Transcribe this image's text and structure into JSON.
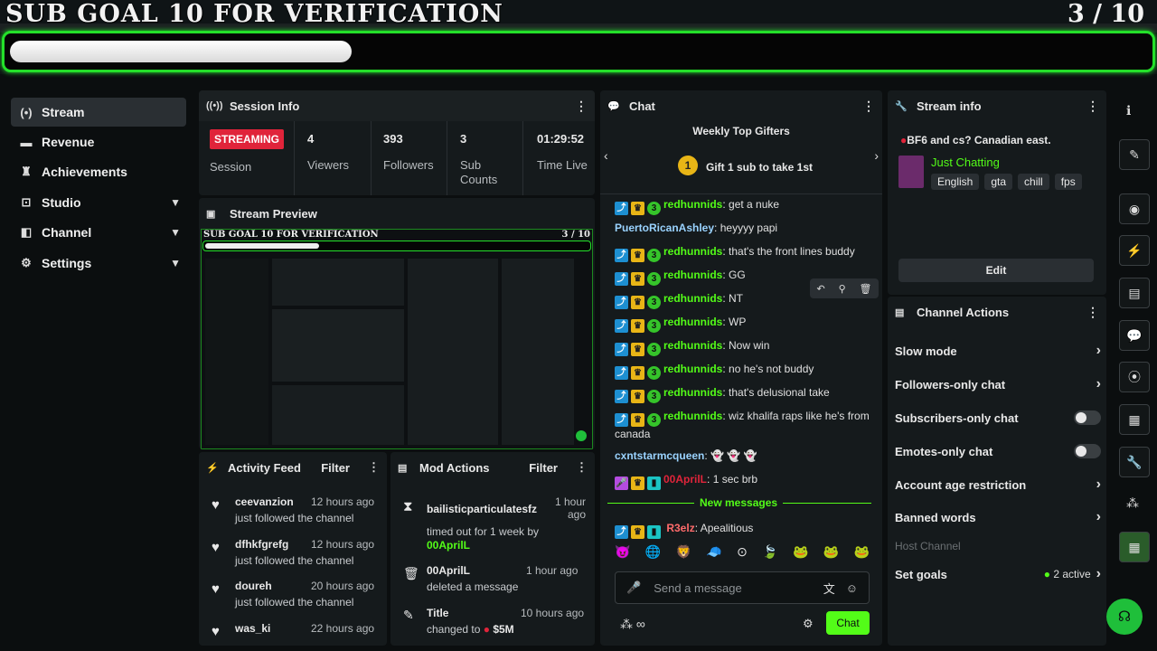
{
  "overlay": {
    "title": "SUB GOAL 10 FOR VERIFICATION",
    "count": "3 / 10",
    "progress_fraction": 0.3
  },
  "sidebar": {
    "items": [
      {
        "label": "Stream",
        "icon": "stream-icon"
      },
      {
        "label": "Revenue",
        "icon": "revenue-icon"
      },
      {
        "label": "Achievements",
        "icon": "trophy-icon"
      },
      {
        "label": "Studio",
        "icon": "studio-icon"
      },
      {
        "label": "Channel",
        "icon": "channel-icon"
      },
      {
        "label": "Settings",
        "icon": "gear-icon"
      }
    ]
  },
  "session": {
    "title": "Session Info",
    "status": "STREAMING",
    "session_label": "Session",
    "viewers": "4",
    "viewers_label": "Viewers",
    "followers": "393",
    "followers_label": "Followers",
    "subs": "3",
    "subs_label": "Sub Counts",
    "time": "01:29:52",
    "time_label": "Time Live"
  },
  "preview": {
    "title": "Stream Preview",
    "overlay_title": "SUB GOAL 10 FOR VERIFICATION",
    "overlay_count": "3 / 10"
  },
  "activity": {
    "title": "Activity Feed",
    "filter": "Filter",
    "rows": [
      {
        "who": "ceevanzion",
        "when": "12 hours ago",
        "what": "just followed the channel"
      },
      {
        "who": "dfhkfgrefg",
        "when": "12 hours ago",
        "what": "just followed the channel"
      },
      {
        "who": "doureh",
        "when": "20 hours ago",
        "what": "just followed the channel"
      },
      {
        "who": "was_ki",
        "when": "22 hours ago",
        "what": ""
      }
    ]
  },
  "mod": {
    "title": "Mod Actions",
    "filter": "Filter",
    "rows": [
      {
        "who": "bailisticparticulatesfz",
        "when": "1 hour ago",
        "what": "timed out for 1 week by",
        "by": "00AprilL"
      },
      {
        "who": "00AprilL",
        "when": "1 hour ago",
        "what": "deleted a message"
      },
      {
        "who": "Title",
        "when": "10 hours ago",
        "what": "changed to",
        "extra": "$5M"
      }
    ]
  },
  "chat": {
    "title": "Chat",
    "gifters_title": "Weekly Top Gifters",
    "gift_rank": "1",
    "gift_text": "Gift 1 sub to take 1st",
    "messages": [
      {
        "user": "redhunnids",
        "text": "get a nuke",
        "badges": true
      },
      {
        "user": "PuertoRicanAshley",
        "text": "heyyyy papi",
        "badges": false,
        "color": "#9ad3ff"
      },
      {
        "user": "redhunnids",
        "text": "that's the front lines buddy",
        "badges": true
      },
      {
        "user": "redhunnids",
        "text": "GG",
        "badges": true
      },
      {
        "user": "redhunnids",
        "text": "NT",
        "badges": true
      },
      {
        "user": "redhunnids",
        "text": "WP",
        "badges": true
      },
      {
        "user": "redhunnids",
        "text": "Now win",
        "badges": true
      },
      {
        "user": "redhunnids",
        "text": "no he's not buddy",
        "badges": true
      },
      {
        "user": "redhunnids",
        "text": "that's delusional take",
        "badges": true
      },
      {
        "user": "redhunnids",
        "text": "wiz khalifa raps like he's from canada",
        "badges": true
      },
      {
        "user": "cxntstarmcqueen",
        "text": "",
        "badges": false,
        "color": "#9ad3ff"
      },
      {
        "user": "00AprilL",
        "text": "1 sec brb",
        "badges": true,
        "color": "#e0243a"
      }
    ],
    "new_messages": "New messages",
    "last": {
      "user": "R3elz",
      "text": "Apealitious"
    },
    "input_placeholder": "Send a message",
    "send_label": "Chat"
  },
  "stream_info": {
    "title": "Stream info",
    "stream_title": "BF6 and cs? Canadian east.",
    "category": "Just Chatting",
    "tags": [
      "English",
      "gta",
      "chill",
      "fps"
    ],
    "edit": "Edit"
  },
  "channel_actions": {
    "title": "Channel Actions",
    "rows": [
      {
        "label": "Slow mode",
        "kind": "arrow"
      },
      {
        "label": "Followers-only chat",
        "kind": "arrow"
      },
      {
        "label": "Subscribers-only chat",
        "kind": "toggle"
      },
      {
        "label": "Emotes-only chat",
        "kind": "toggle"
      },
      {
        "label": "Account age restriction",
        "kind": "arrow"
      },
      {
        "label": "Banned words",
        "kind": "arrow"
      },
      {
        "label": "Host Channel",
        "kind": "disabled"
      },
      {
        "label": "Set goals",
        "kind": "arrow",
        "extra": "2 active"
      }
    ]
  },
  "colors": {
    "brand": "#53fc18",
    "live": "#e0243a",
    "panel": "#151a1c"
  }
}
